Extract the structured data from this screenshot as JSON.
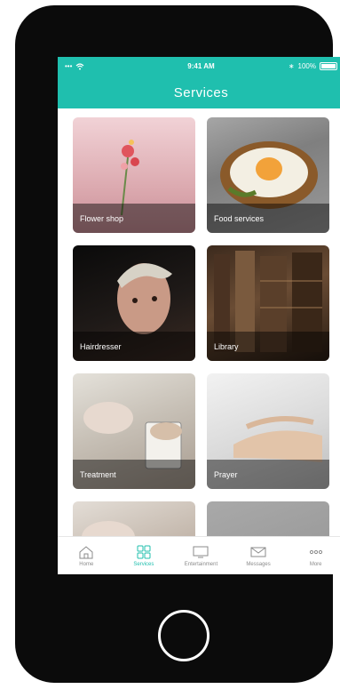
{
  "status_bar": {
    "signal": "•••",
    "time": "9:41 AM",
    "battery": "100%"
  },
  "header": {
    "title": "Services"
  },
  "tiles": [
    {
      "label": "Flower shop"
    },
    {
      "label": "Food services"
    },
    {
      "label": "Hairdresser"
    },
    {
      "label": "Library"
    },
    {
      "label": "Treatment"
    },
    {
      "label": "Prayer"
    }
  ],
  "tab_bar": {
    "items": [
      {
        "label": "Home",
        "icon": "house-icon"
      },
      {
        "label": "Services",
        "icon": "grid-icon"
      },
      {
        "label": "Entertainment",
        "icon": "tv-icon"
      },
      {
        "label": "Messages",
        "icon": "envelope-icon"
      },
      {
        "label": "More",
        "icon": "ellipsis-icon"
      }
    ],
    "active_index": 1
  },
  "colors": {
    "accent": "#1fbfae",
    "tab_inactive": "#8b8b8b"
  }
}
